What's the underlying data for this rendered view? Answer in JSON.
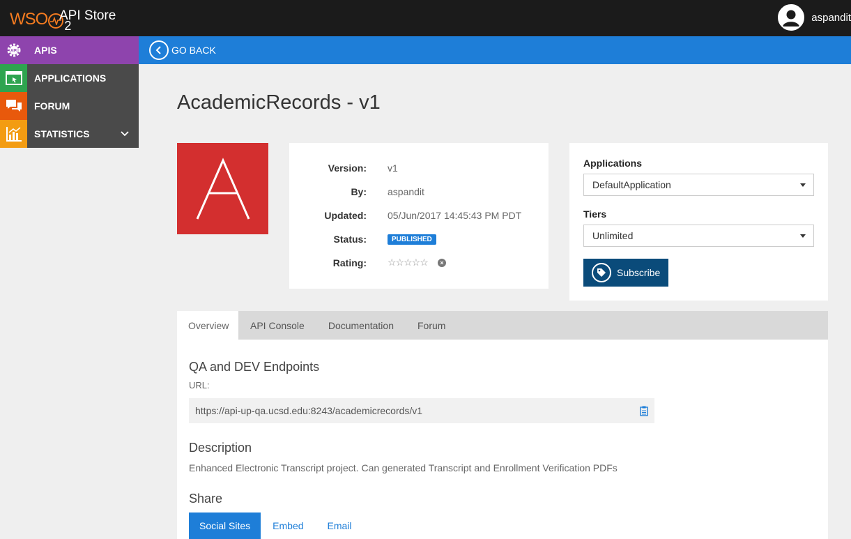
{
  "header": {
    "logo_text": "WSO",
    "logo_sub": "2",
    "app_title": "API Store",
    "username": "aspandit",
    "user_icon": "user-avatar-icon"
  },
  "sidebar": {
    "items": [
      {
        "label": "APIS",
        "icon": "api-gear-icon",
        "color": "#8e44ad",
        "active": true
      },
      {
        "label": "APPLICATIONS",
        "icon": "application-window-icon",
        "color": "#2ea44f"
      },
      {
        "label": "FORUM",
        "icon": "chat-bubbles-icon",
        "color": "#e8590c"
      },
      {
        "label": "STATISTICS",
        "icon": "bar-chart-icon",
        "color": "#f39c12",
        "expandable": true
      }
    ]
  },
  "nav": {
    "go_back_label": "GO BACK"
  },
  "api": {
    "title": "AcademicRecords - v1",
    "thumbnail_letter": "A",
    "thumbnail_color": "#d32f2f",
    "info": {
      "version_key": "Version:",
      "version": "v1",
      "by_key": "By:",
      "by": "aspandit",
      "updated_key": "Updated:",
      "updated": "05/Jun/2017 14:45:43 PM PDT",
      "status_key": "Status:",
      "status": "PUBLISHED",
      "rating_key": "Rating:",
      "rating_value": 0,
      "rating_max": 5
    }
  },
  "subscription": {
    "applications_label": "Applications",
    "applications_value": "DefaultApplication",
    "tiers_label": "Tiers",
    "tiers_value": "Unlimited",
    "subscribe_label": "Subscribe"
  },
  "tabs": [
    {
      "label": "Overview",
      "active": true
    },
    {
      "label": "API Console"
    },
    {
      "label": "Documentation"
    },
    {
      "label": "Forum"
    }
  ],
  "overview": {
    "endpoints_title": "QA and DEV Endpoints",
    "url_label": "URL:",
    "url": "https://api-up-qa.ucsd.edu:8243/academicrecords/v1",
    "description_title": "Description",
    "description": "Enhanced Electronic Transcript project. Can generated Transcript and Enrollment Verification PDFs",
    "share_title": "Share",
    "share_tabs": [
      {
        "label": "Social Sites",
        "active": true
      },
      {
        "label": "Embed"
      },
      {
        "label": "Email"
      }
    ]
  }
}
